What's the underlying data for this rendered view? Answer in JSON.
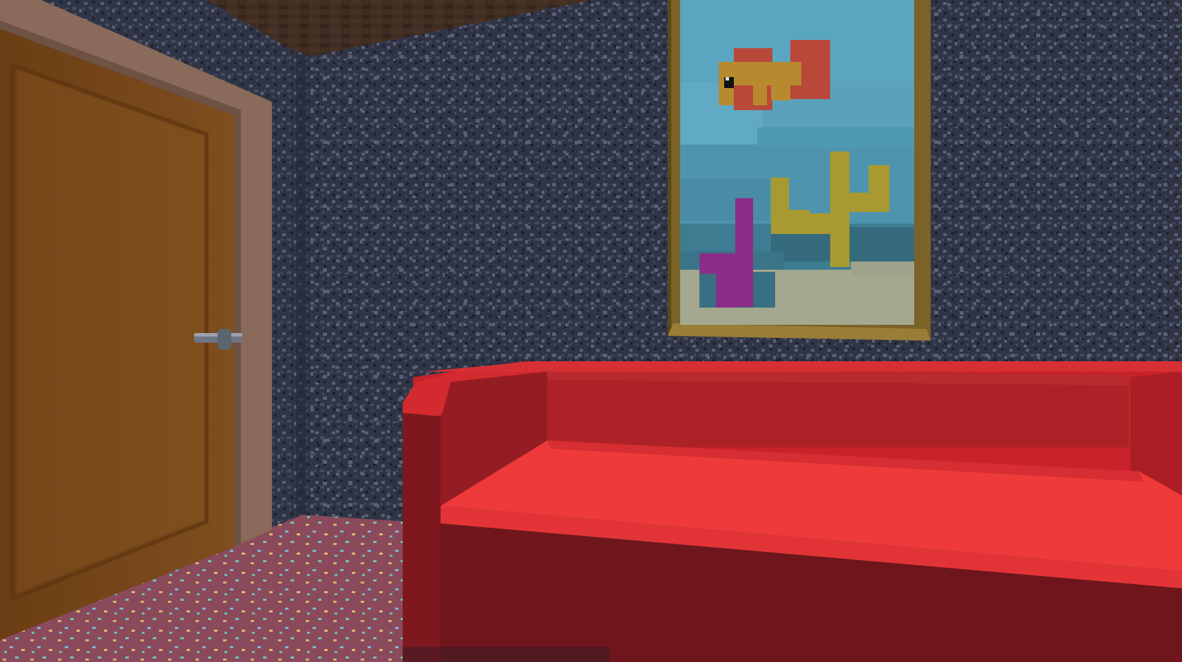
{
  "scene": {
    "view": "first-person",
    "room": "living-room",
    "objects": [
      "door",
      "door-handle",
      "framed-pixel-art-painting",
      "red-sofa",
      "speckled-wallpaper",
      "speckled-carpet",
      "wooden-ceiling"
    ]
  },
  "painting": {
    "subject": "pixel-art-underwater-scene",
    "elements": [
      "fish",
      "yellow-coral",
      "purple-coral",
      "sandy-seabed"
    ]
  },
  "colors": {
    "wall": "#2f3545",
    "wall_speckle_light": "#5a6078",
    "wall_speckle_dark": "#1e2230",
    "ceiling": "#4a3528",
    "floor": "#8a4a5c",
    "door": "#7a4a1c",
    "door_frame": "#8a6a5a",
    "handle": "#6e7684",
    "frame_gold": "#7a6228",
    "water_top": "#5aa6c0",
    "water_mid": "#4e94ae",
    "water_deep": "#356b7c",
    "sand": "#a4a88e",
    "fish_body": "#b88a30",
    "fish_fin": "#b84838",
    "coral_yellow": "#a89a30",
    "coral_purple": "#8a2e8a",
    "sofa_light": "#ee3a3a",
    "sofa_mid": "#c8222a",
    "sofa_dark": "#8a1a20",
    "sofa_shadow": "#6e161c"
  }
}
